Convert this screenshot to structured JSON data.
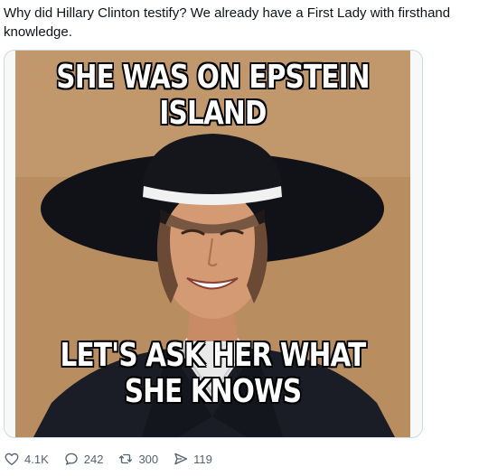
{
  "post": {
    "text": "Why did Hillary Clinton testify? We already have a First Lady with firsthand knowledge."
  },
  "meme": {
    "top_caption": "SHE WAS ON EPSTEIN ISLAND",
    "bottom_caption": "LET'S ASK HER WHAT SHE KNOWS"
  },
  "actions": {
    "likes": "4.1K",
    "replies": "242",
    "reposts": "300",
    "views": "119"
  },
  "icons": {
    "like": "heart-icon",
    "reply": "speech-bubble-icon",
    "repost": "repost-arrows-icon",
    "share": "send-arrow-icon"
  },
  "colors": {
    "text": "#0f1419",
    "muted": "#536471",
    "border": "#cfd9de"
  }
}
